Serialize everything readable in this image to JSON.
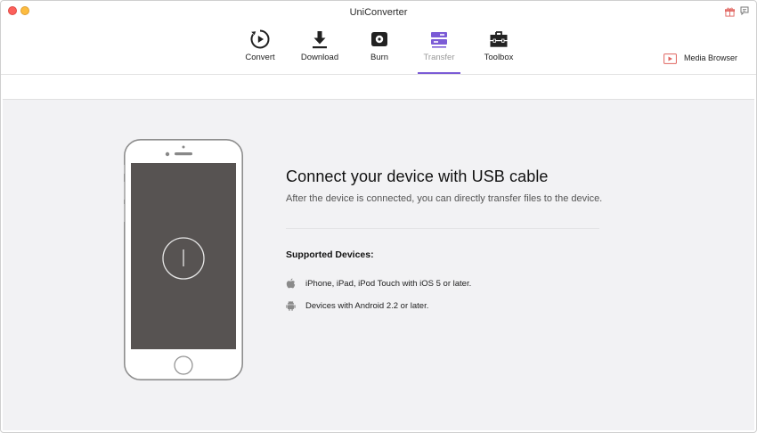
{
  "app": {
    "title": "UniConverter"
  },
  "toolbar": {
    "items": [
      {
        "label": "Convert",
        "icon": "convert-icon",
        "active": false
      },
      {
        "label": "Download",
        "icon": "download-icon",
        "active": false
      },
      {
        "label": "Burn",
        "icon": "burn-icon",
        "active": false
      },
      {
        "label": "Transfer",
        "icon": "transfer-icon",
        "active": true
      },
      {
        "label": "Toolbox",
        "icon": "toolbox-icon",
        "active": false
      }
    ],
    "media_browser_label": "Media Browser"
  },
  "main": {
    "headline": "Connect your device with USB cable",
    "subline": "After the device is connected, you can directly transfer files to the device.",
    "supported_title": "Supported Devices:",
    "devices": [
      {
        "icon": "apple-icon",
        "text": "iPhone, iPad, iPod Touch with iOS 5 or later."
      },
      {
        "icon": "android-icon",
        "text": "Devices with Android 2.2 or later."
      }
    ]
  },
  "colors": {
    "accent": "#7b5bd6",
    "content_bg": "#f2f2f4",
    "phone_screen": "#575352"
  }
}
